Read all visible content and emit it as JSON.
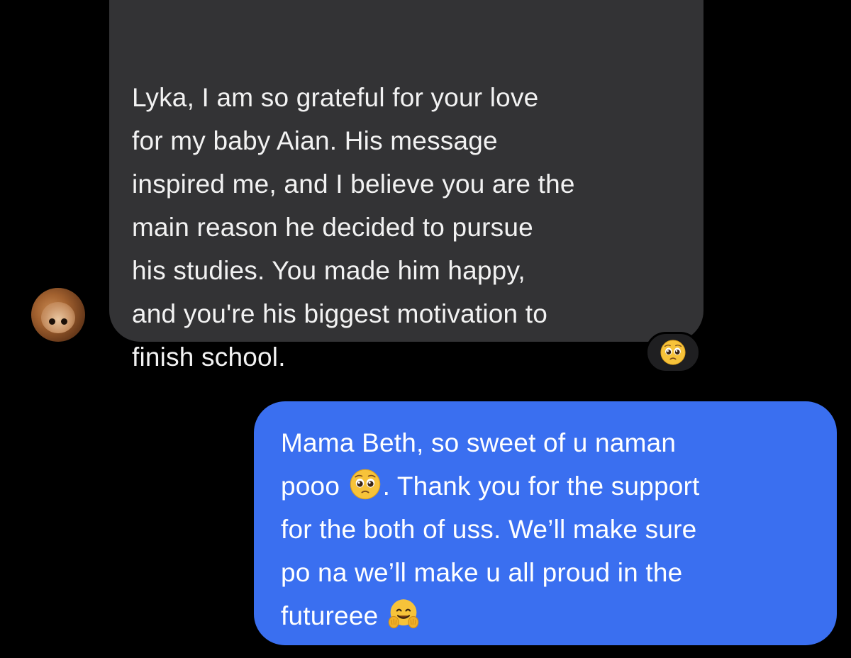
{
  "conversation": {
    "incoming": {
      "text": "Lyka, I am so grateful for your love\nfor my baby Aian. His message\ninspired me, and I believe you are the\nmain reason he decided to pursue\nhis studies. You made him happy,\nand you're his biggest motivation to\nfinish school.",
      "reaction_icon": "pleading-face-emoji-icon"
    },
    "outgoing": {
      "line1": "Mama Beth, so sweet of u naman\npooo ",
      "line2": ". Thank you for the support\nfor the both of uss. We’ll make sure\npo na we’ll make u all proud in the\nfutureee ",
      "emoji1": "pleading-face-emoji-icon",
      "emoji2": "hugging-face-emoji-icon"
    }
  },
  "colors": {
    "background": "#000000",
    "incoming_bubble": "#333335",
    "outgoing_bubble": "#3a6ff0",
    "incoming_text": "#f2f2f2",
    "outgoing_text": "#ffffff"
  }
}
